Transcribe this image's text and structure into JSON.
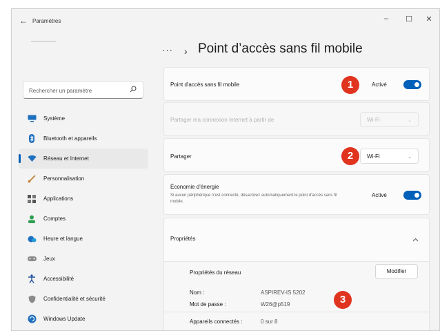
{
  "window": {
    "title": "Paramètres",
    "back_glyph": "←",
    "minimize": "–",
    "maximize": "☐",
    "close": "✕"
  },
  "search": {
    "placeholder": "Rechercher un paramètre"
  },
  "sidebar": {
    "items": [
      {
        "label": "Système",
        "icon": "monitor-icon",
        "selected": false
      },
      {
        "label": "Bluetooth et appareils",
        "icon": "bluetooth-icon",
        "selected": false
      },
      {
        "label": "Réseau et Internet",
        "icon": "wifi-icon",
        "selected": true
      },
      {
        "label": "Personnalisation",
        "icon": "brush-icon",
        "selected": false
      },
      {
        "label": "Applications",
        "icon": "apps-icon",
        "selected": false
      },
      {
        "label": "Comptes",
        "icon": "account-icon",
        "selected": false
      },
      {
        "label": "Heure et langue",
        "icon": "globe-clock-icon",
        "selected": false
      },
      {
        "label": "Jeux",
        "icon": "gamepad-icon",
        "selected": false
      },
      {
        "label": "Accessibilité",
        "icon": "accessibility-icon",
        "selected": false
      },
      {
        "label": "Confidentialité et sécurité",
        "icon": "shield-icon",
        "selected": false
      },
      {
        "label": "Windows Update",
        "icon": "update-icon",
        "selected": false
      }
    ]
  },
  "header": {
    "dots": "···",
    "chevron": "›",
    "title": "Point d’accès sans fil mobile"
  },
  "hotspot": {
    "label": "Point d'accès sans fil mobile",
    "state": "Activé",
    "on": true
  },
  "share_from": {
    "label": "Partager ma connexion Internet à partir de",
    "value": "Wi-Fi"
  },
  "share_over": {
    "label": "Partager",
    "value": "Wi-Fi"
  },
  "power_saving": {
    "label": "Économie d'énergie",
    "description": "Si aucun périphérique n'est connecté, désactivez automatiquement le point d'accès sans fil mobile.",
    "state": "Activé",
    "on": true
  },
  "properties": {
    "label": "Propriétés",
    "network_props_label": "Propriétés du réseau",
    "modify_label": "Modifier",
    "name_label": "Nom :",
    "name_value": "ASPIREV-IS 5202",
    "password_label": "Mot de passe :",
    "password_value": "W26@p519",
    "devices_label": "Appareils connectés :",
    "devices_value": "0 sur 8"
  },
  "badges": {
    "one": "1",
    "two": "2",
    "three": "3"
  },
  "colors": {
    "accent": "#005fb8",
    "badge": "#e0341f"
  }
}
